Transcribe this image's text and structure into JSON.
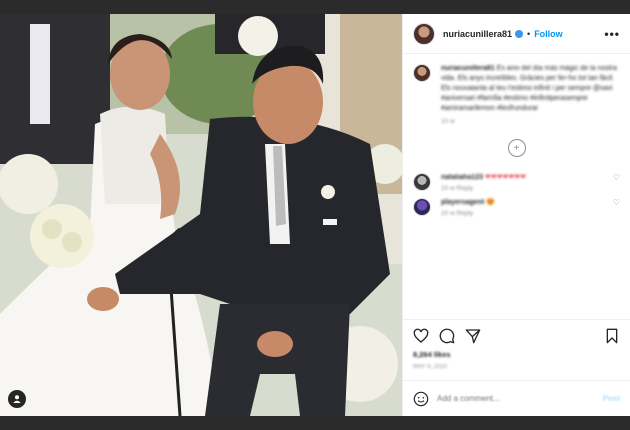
{
  "header": {
    "username": "nuriacunillera81",
    "separator": "•",
    "follow_label": "Follow",
    "more_label": "•••"
  },
  "caption": {
    "username": "nuriacunillera81",
    "text": "Es aniv del día más mágic de la nostra vida. Els anys increïbles. Gràcies per fer-ho tot tan fàcil. Els nouvaianta al teu t'estimo infinit i per sempre @xavi #aniversari #família #estimo #infinitperasempre #amiramarilemon #lesfrundurar",
    "time": "10 w"
  },
  "comments": [
    {
      "username": "nataliaha123",
      "text": "❤❤❤❤❤❤❤",
      "meta": "10 w  Reply"
    },
    {
      "username": "playersagent",
      "text": "😍",
      "meta": "10 w  Reply"
    }
  ],
  "stats": {
    "likes": "8,264 likes",
    "date": "MAY 9, 2020"
  },
  "add_comment": {
    "placeholder": "Add a comment...",
    "post_label": "Post"
  },
  "colors": {
    "link_blue": "#0095f6",
    "verified_blue": "#3897f0",
    "heart_red": "#ed4956"
  }
}
